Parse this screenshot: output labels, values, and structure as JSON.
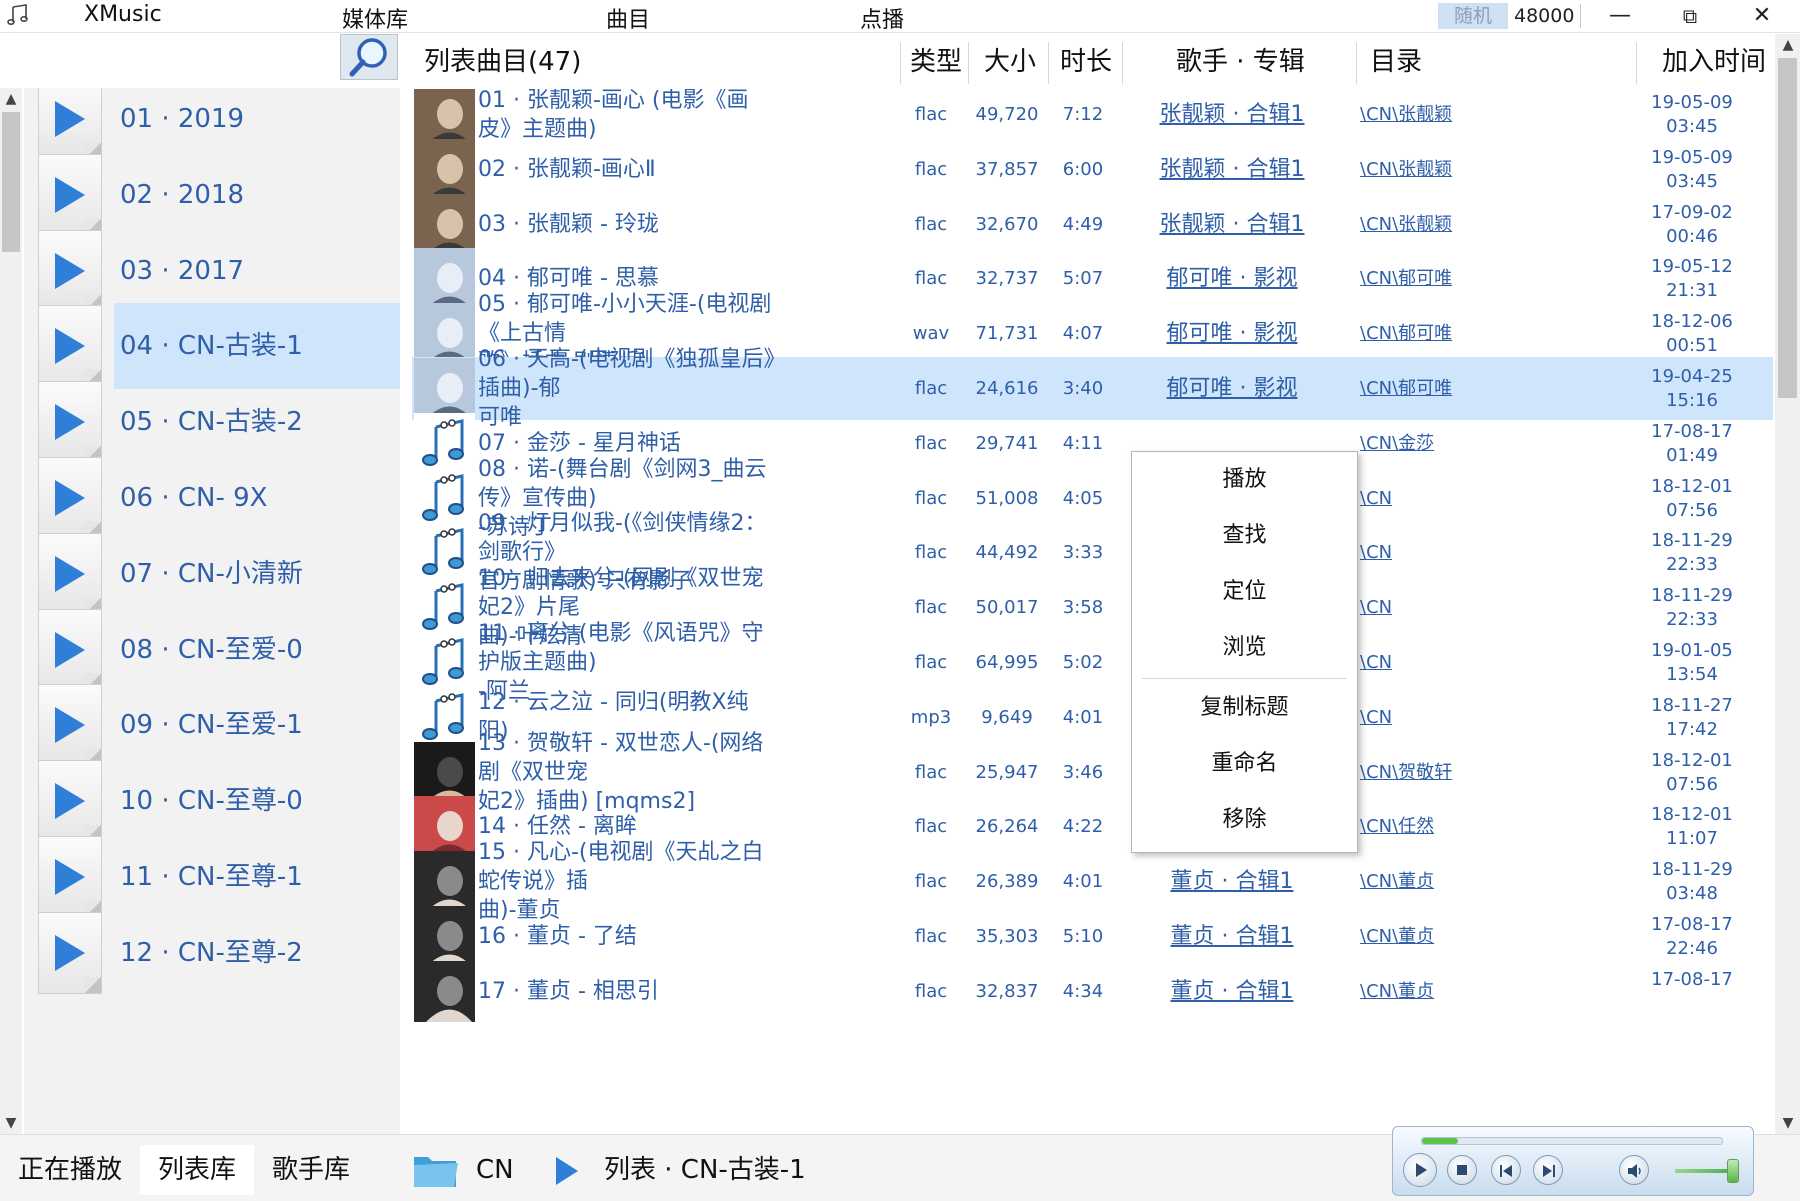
{
  "titlebar": {
    "app_name": "XMusic",
    "menu": [
      "媒体库",
      "曲目",
      "点播"
    ],
    "random_label": "随机",
    "sample_rate": "48000",
    "minimize": "—",
    "restore": "⧉",
    "close": "✕"
  },
  "search": {
    "placeholder": "",
    "value": ""
  },
  "playlists": [
    {
      "label": "01 · 2019"
    },
    {
      "label": "02 · 2018"
    },
    {
      "label": "03 · 2017"
    },
    {
      "label": "04 · CN-古装-1",
      "selected": true
    },
    {
      "label": "05 · CN-古装-2"
    },
    {
      "label": "06 · CN- 9X"
    },
    {
      "label": "07 · CN-小清新"
    },
    {
      "label": "08 · CN-至爱-0"
    },
    {
      "label": "09 · CN-至爱-1"
    },
    {
      "label": "10 · CN-至尊-0"
    },
    {
      "label": "11 · CN-至尊-1"
    },
    {
      "label": "12 · CN-至尊-2"
    }
  ],
  "table": {
    "headers": {
      "title": "列表曲目(47)",
      "type": "类型",
      "size": "大小",
      "duration": "时长",
      "artist": "歌手 · 专辑",
      "dir": "目录",
      "added": "加入时间"
    },
    "rows": [
      {
        "title": [
          "01 · 张靓颖-画心 (电影《画皮》主题曲)"
        ],
        "type": "flac",
        "size": "49,720",
        "duration": "7:12",
        "artist": "张靓颖 · 合辑1",
        "dir": "\\CN\\张靓颖",
        "date": "19-05-09",
        "time": "03:45",
        "cover": "photo-a"
      },
      {
        "title": [
          "02 · 张靓颖-画心Ⅱ"
        ],
        "type": "flac",
        "size": "37,857",
        "duration": "6:00",
        "artist": "张靓颖 · 合辑1",
        "dir": "\\CN\\张靓颖",
        "date": "19-05-09",
        "time": "03:45",
        "cover": "photo-a"
      },
      {
        "title": [
          "03 · 张靓颖 - 玲珑"
        ],
        "type": "flac",
        "size": "32,670",
        "duration": "4:49",
        "artist": "张靓颖 · 合辑1",
        "dir": "\\CN\\张靓颖",
        "date": "17-09-02",
        "time": "00:46",
        "cover": "photo-a"
      },
      {
        "title": [
          "04 · 郁可唯 - 思慕"
        ],
        "type": "flac",
        "size": "32,737",
        "duration": "5:07",
        "artist": "郁可唯 · 影视",
        "dir": "\\CN\\郁可唯",
        "date": "19-05-12",
        "time": "21:31",
        "cover": "photo-b"
      },
      {
        "title": [
          "05 · 郁可唯-小小天涯-(电视剧《上古情",
          "歌》插曲 剧情版)"
        ],
        "type": "wav",
        "size": "71,731",
        "duration": "4:07",
        "artist": "郁可唯 · 影视",
        "dir": "\\CN\\郁可唯",
        "date": "18-12-06",
        "time": "00:51",
        "cover": "photo-b"
      },
      {
        "title": [
          "06 · 天高-(电视剧《独孤皇后》插曲)-郁",
          "可唯"
        ],
        "type": "flac",
        "size": "24,616",
        "duration": "3:40",
        "artist": "郁可唯 · 影视",
        "dir": "\\CN\\郁可唯",
        "date": "19-04-25",
        "time": "15:16",
        "cover": "photo-b",
        "selected": true
      },
      {
        "title": [
          "07 · 金莎 - 星月神话"
        ],
        "type": "flac",
        "size": "29,741",
        "duration": "4:11",
        "artist": "",
        "dir": "\\CN\\金莎",
        "date": "17-08-17",
        "time": "01:49",
        "cover": "note"
      },
      {
        "title": [
          "08 · 诺-(舞台剧《剑网3_曲云传》宣传曲)",
          "-苏诗丁"
        ],
        "type": "flac",
        "size": "51,008",
        "duration": "4:05",
        "artist": "",
        "dir": "\\CN",
        "date": "18-12-01",
        "time": "07:56",
        "cover": "note"
      },
      {
        "title": [
          "09 · 灯月似我-(《剑侠情缘2：剑歌行》",
          "官方剧情歌)-只有影子"
        ],
        "type": "flac",
        "size": "44,492",
        "duration": "3:33",
        "artist": "",
        "dir": "\\CN",
        "date": "18-11-29",
        "time": "22:33",
        "cover": "note"
      },
      {
        "title": [
          "10 · 归去来兮-(网剧《双世宠妃2》片尾",
          "曲)-叶炫清"
        ],
        "type": "flac",
        "size": "50,017",
        "duration": "3:58",
        "artist": "",
        "dir": "\\CN",
        "date": "18-11-29",
        "time": "22:33",
        "cover": "note"
      },
      {
        "title": [
          "11 · 离兮-(电影《风语咒》守护版主题曲)",
          "-阿兰"
        ],
        "type": "flac",
        "size": "64,995",
        "duration": "5:02",
        "artist": "",
        "dir": "\\CN",
        "date": "19-01-05",
        "time": "13:54",
        "cover": "note"
      },
      {
        "title": [
          "12 · 云之泣 - 同归(明教X纯阳)"
        ],
        "type": "mp3",
        "size": "9,649",
        "duration": "4:01",
        "artist": "",
        "dir": "\\CN",
        "date": "18-11-27",
        "time": "17:42",
        "cover": "note"
      },
      {
        "title": [
          "13 · 贺敬轩 - 双世恋人-(网络剧《双世宠",
          "妃2》插曲) [mqms2]"
        ],
        "type": "flac",
        "size": "25,947",
        "duration": "3:46",
        "artist": "贺敬轩 · 合辑1",
        "dir": "\\CN\\贺敬轩",
        "date": "18-12-01",
        "time": "07:56",
        "cover": "photo-c"
      },
      {
        "title": [
          "14 · 任然 - 离眸"
        ],
        "type": "flac",
        "size": "26,264",
        "duration": "4:22",
        "artist": "任然 · 合辑1",
        "dir": "\\CN\\任然",
        "date": "18-12-01",
        "time": "11:07",
        "cover": "photo-d"
      },
      {
        "title": [
          "15 · 凡心-(电视剧《天乩之白蛇传说》插",
          "曲)-董贞"
        ],
        "type": "flac",
        "size": "26,389",
        "duration": "4:01",
        "artist": "董贞 · 合辑1",
        "dir": "\\CN\\董贞",
        "date": "18-11-29",
        "time": "03:48",
        "cover": "photo-e"
      },
      {
        "title": [
          "16 · 董贞 - 了结"
        ],
        "type": "flac",
        "size": "35,303",
        "duration": "5:10",
        "artist": "董贞 · 合辑1",
        "dir": "\\CN\\董贞",
        "date": "17-08-17",
        "time": "22:46",
        "cover": "photo-e"
      },
      {
        "title": [
          "17 · 董贞 - 相思引"
        ],
        "type": "flac",
        "size": "32,837",
        "duration": "4:34",
        "artist": "董贞 · 合辑1",
        "dir": "\\CN\\董贞",
        "date": "17-08-17",
        "time": "",
        "cover": "photo-e"
      }
    ]
  },
  "context_menu": {
    "items": [
      "播放",
      "查找",
      "定位",
      "浏览",
      "复制标题",
      "重命名",
      "移除"
    ]
  },
  "bottom": {
    "tabs": [
      "正在播放",
      "列表库",
      "歌手库"
    ],
    "breadcrumb": [
      "CN",
      "列表 · CN-古装-1"
    ]
  },
  "player": {
    "progress": 0.12,
    "volume": 0.95
  },
  "colors": {
    "link": "#2f5fa9",
    "selected_row": "#cfe5fb",
    "play_triangle": "#2f7fd8"
  },
  "icons": {
    "app": "music-note-icon",
    "search": "magnifier-icon",
    "playlist": "play-triangle-icon",
    "folder": "folder-icon"
  }
}
